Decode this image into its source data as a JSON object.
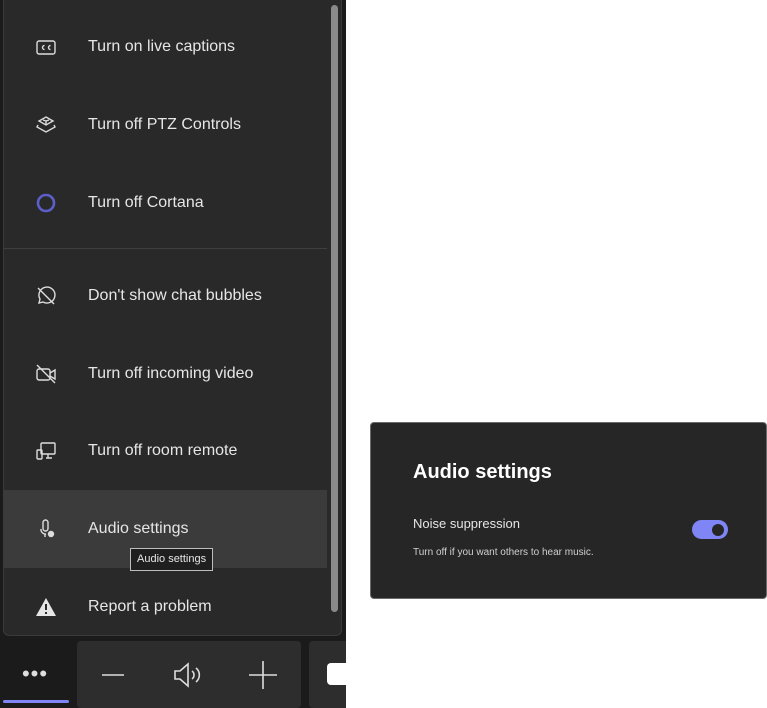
{
  "menu": {
    "items": [
      {
        "label": "Turn on live captions",
        "icon": "closed-captions-icon"
      },
      {
        "label": "Turn off PTZ Controls",
        "icon": "ptz-camera-icon"
      },
      {
        "label": "Turn off Cortana",
        "icon": "cortana-icon"
      },
      {
        "label": "Don't show chat bubbles",
        "icon": "chat-off-icon"
      },
      {
        "label": "Turn off incoming video",
        "icon": "video-off-icon"
      },
      {
        "label": "Turn off room remote",
        "icon": "room-remote-icon"
      },
      {
        "label": "Audio settings",
        "icon": "mic-settings-icon"
      },
      {
        "label": "Report a problem",
        "icon": "warning-icon"
      }
    ],
    "tooltip": "Audio settings",
    "accent": "#7f85f5"
  },
  "audio_panel": {
    "title": "Audio settings",
    "noise_label": "Noise suppression",
    "noise_desc": "Turn off if you want others to hear music.",
    "noise_on": true
  }
}
